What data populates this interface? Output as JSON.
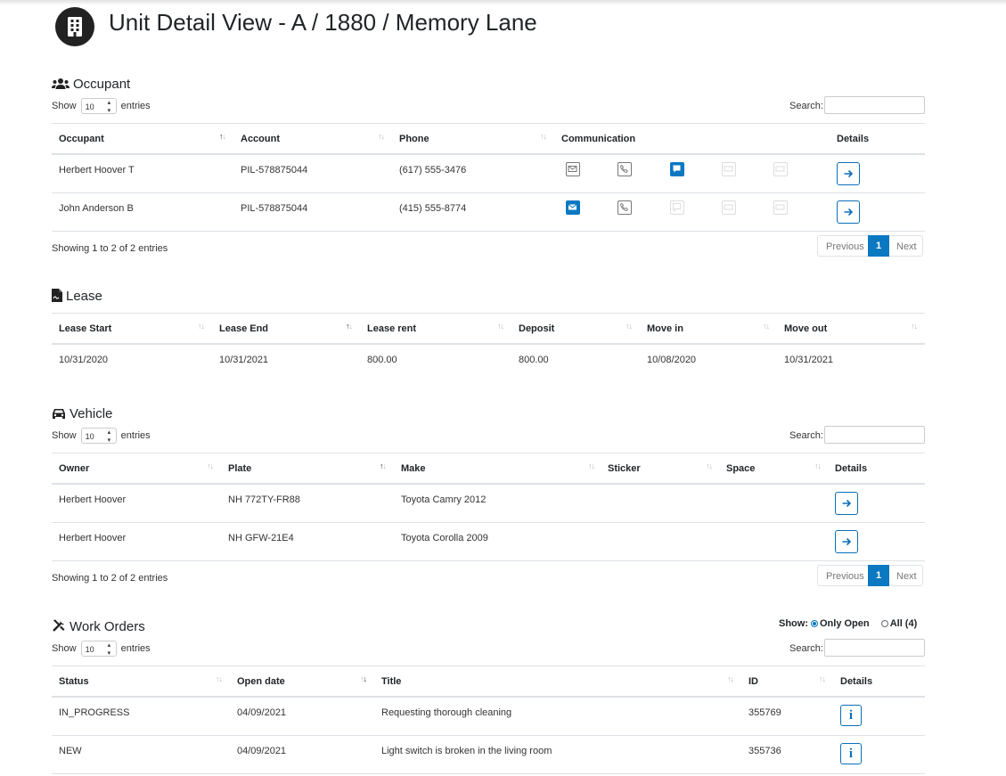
{
  "header": {
    "title": "Unit Detail View - A / 1880 / Memory Lane"
  },
  "common": {
    "show_label": "Show",
    "entries_label": "entries",
    "page_length": "10",
    "search_label": "Search:",
    "previous": "Previous",
    "next": "Next",
    "page": "1"
  },
  "occupant": {
    "title": "Occupant",
    "columns": [
      "Occupant",
      "Account",
      "Phone",
      "Communication",
      "Details"
    ],
    "rows": [
      {
        "occupant": "Herbert Hoover T",
        "account": "PIL-578875044",
        "phone": "(617) 555-3476",
        "comm": {
          "email": "enabled",
          "phone": "enabled",
          "sms": "active",
          "mail": "disabled",
          "other": "disabled"
        }
      },
      {
        "occupant": "John Anderson B",
        "account": "PIL-578875044",
        "phone": "(415) 555-8774",
        "comm": {
          "email": "active",
          "phone": "enabled",
          "sms": "disabled",
          "mail": "disabled",
          "other": "disabled"
        }
      }
    ],
    "info": "Showing 1 to 2 of 2 entries"
  },
  "lease": {
    "title": "Lease",
    "columns": [
      "Lease Start",
      "Lease End",
      "Lease rent",
      "Deposit",
      "Move in",
      "Move out"
    ],
    "row": [
      "10/31/2020",
      "10/31/2021",
      "800.00",
      "800.00",
      "10/08/2020",
      "10/31/2021"
    ]
  },
  "vehicle": {
    "title": "Vehicle",
    "columns": [
      "Owner",
      "Plate",
      "Make",
      "Sticker",
      "Space",
      "Details"
    ],
    "rows": [
      {
        "owner": "Herbert Hoover",
        "plate": "NH 772TY-FR88",
        "make": "Toyota Camry 2012"
      },
      {
        "owner": "Herbert Hoover",
        "plate": "NH GFW-21E4",
        "make": "Toyota Corolla 2009"
      }
    ],
    "info": "Showing 1 to 2 of 2 entries"
  },
  "work_orders": {
    "title": "Work Orders",
    "show_label": "Show:",
    "only_open": "Only Open",
    "all": "All (4)",
    "columns": [
      "Status",
      "Open date",
      "Title",
      "ID",
      "Details"
    ],
    "rows": [
      {
        "status": "IN_PROGRESS",
        "open_date": "04/09/2021",
        "title": "Requesting thorough cleaning",
        "id": "355769"
      },
      {
        "status": "NEW",
        "open_date": "04/09/2021",
        "title": "Light switch is broken in the living room",
        "id": "355736"
      }
    ]
  },
  "colors": {
    "accent": "#0b78c2",
    "border": "#dee2e6"
  },
  "icons": [
    "building-icon",
    "users-icon",
    "file-contract-icon",
    "car-icon",
    "tools-icon",
    "envelope-icon",
    "phone-icon",
    "message-icon",
    "mailbox-icon",
    "card-icon",
    "arrow-right-icon",
    "info-icon"
  ]
}
